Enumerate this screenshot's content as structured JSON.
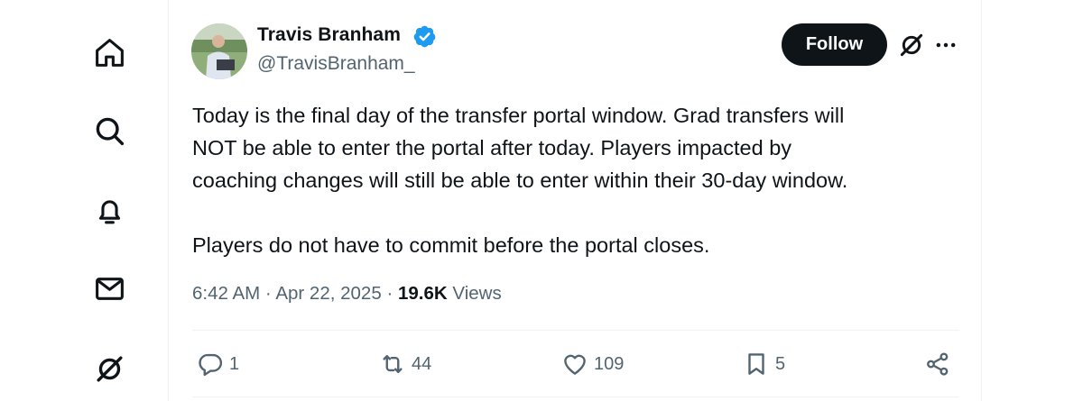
{
  "nav": {
    "items": [
      {
        "name": "home-icon"
      },
      {
        "name": "explore-icon"
      },
      {
        "name": "notifications-icon"
      },
      {
        "name": "messages-icon"
      },
      {
        "name": "grok-icon"
      }
    ]
  },
  "tweet": {
    "author": {
      "name": "Travis Branham",
      "handle": "@TravisBranham_",
      "verified": true,
      "verified_color": "#1d9bf0"
    },
    "follow_label": "Follow",
    "paragraphs": [
      "Today is the final day of the transfer portal window. Grad transfers will\nNOT be able to enter the portal after today. Players impacted by\ncoaching changes will still be able to enter within their 30-day window.",
      "Players do not have to commit before the portal closes."
    ],
    "time": "6:42 AM",
    "separator": "·",
    "date": "Apr 22, 2025",
    "views_count": "19.6K",
    "views_label": "Views",
    "actions": {
      "replies": "1",
      "reposts": "44",
      "likes": "109",
      "bookmarks": "5"
    }
  },
  "colors": {
    "text": "#0f1419",
    "secondary": "#536471",
    "border": "#eff3f4",
    "accent": "#1d9bf0"
  }
}
